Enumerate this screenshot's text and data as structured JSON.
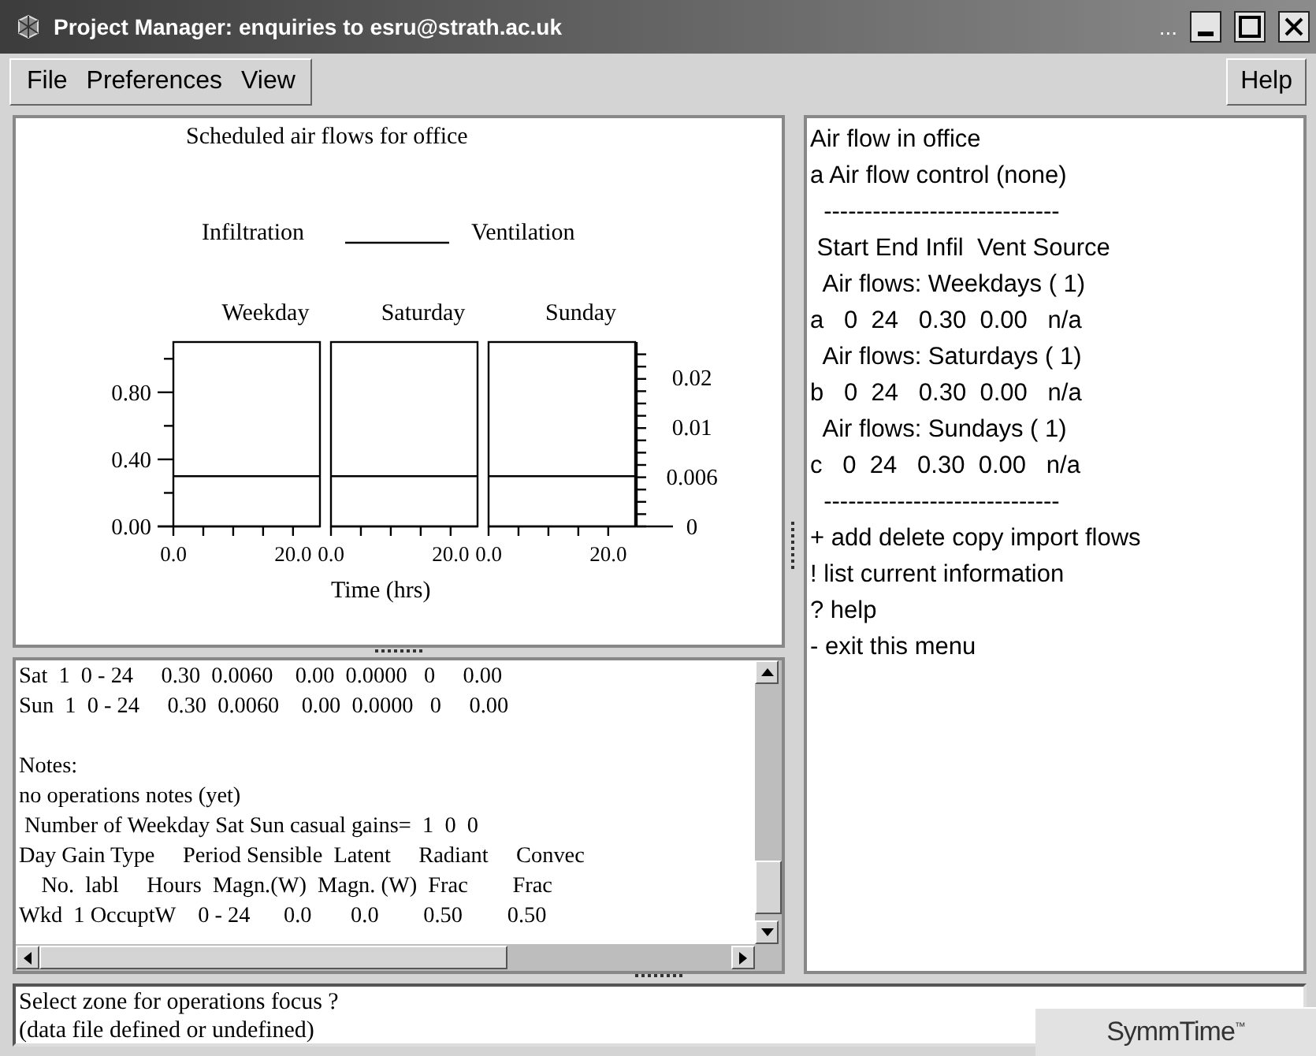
{
  "window": {
    "title": "Project Manager: enquiries to esru@strath.ac.uk",
    "title_extra": "..."
  },
  "menu_bar": {
    "menus": [
      "File",
      "Preferences",
      "View"
    ],
    "help": "Help"
  },
  "graph": {
    "title": "Scheduled air flows for office",
    "legend": [
      "Infiltration",
      "Ventilation"
    ],
    "xlabel": "Time (hrs)",
    "left_axis_labels": [
      "0.80",
      "0.40",
      "0.00"
    ],
    "right_axis_labels": [
      "0.02",
      "0.01",
      "0.006",
      "0"
    ],
    "panels": [
      {
        "title": "Weekday",
        "x_labels": [
          "0.0",
          "20.0"
        ]
      },
      {
        "title": "Saturday",
        "x_labels": [
          "0.0",
          "20.0"
        ]
      },
      {
        "title": "Sunday",
        "x_labels": [
          "0.0",
          "20.0"
        ]
      }
    ]
  },
  "text_pane": {
    "rows": [
      "Sat  1  0 - 24     0.30  0.0060    0.00  0.0000   0     0.00",
      "Sun  1  0 - 24     0.30  0.0060    0.00  0.0000   0     0.00"
    ],
    "notes": [
      "Notes:",
      "no operations notes (yet)",
      " Number of Weekday Sat Sun casual gains=  1  0  0",
      "Day Gain Type     Period Sensible  Latent     Radiant     Convec",
      "    No.  labl     Hours  Magn.(W)  Magn. (W)  Frac        Frac",
      "Wkd  1 OccuptW    0 - 24      0.0       0.0        0.50        0.50"
    ]
  },
  "menu_pane": {
    "lines": [
      "Air flow in office",
      "a Air flow control (none)",
      "  -----------------------------",
      " Start End Infil  Vent Source",
      "  Air flows: Weekdays ( 1)",
      "a   0  24   0.30  0.00   n/a",
      "  Air flows: Saturdays ( 1)",
      "b   0  24   0.30  0.00   n/a",
      "  Air flows: Sundays ( 1)",
      "c   0  24   0.30  0.00   n/a",
      "  -----------------------------",
      "+ add delete copy import flows",
      "! list current information",
      "? help",
      "- exit this menu"
    ]
  },
  "status": {
    "lines": [
      "Select zone for operations focus ?",
      "(data file defined or undefined)"
    ]
  },
  "overlay_window": {
    "logo": "SymmTime",
    "mark": "™"
  }
}
